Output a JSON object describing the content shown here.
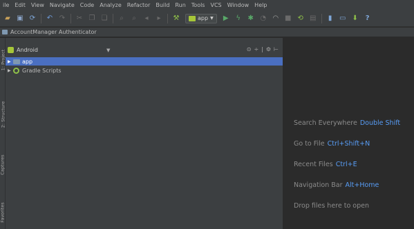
{
  "menubar": [
    "ile",
    "Edit",
    "View",
    "Navigate",
    "Code",
    "Analyze",
    "Refactor",
    "Build",
    "Run",
    "Tools",
    "VCS",
    "Window",
    "Help"
  ],
  "toolbar": {
    "run_config": "app",
    "help_glyph": "?"
  },
  "navbar": {
    "project_name": "AccountManager Authenticator"
  },
  "side_tabs": [
    "1: Project",
    "2: Structure",
    "Captures",
    "Favorites"
  ],
  "project_panel": {
    "view_mode": "Android",
    "tree": [
      {
        "label": "app",
        "selected": true,
        "icon": "folder-icon"
      },
      {
        "label": "Gradle Scripts",
        "selected": false,
        "icon": "gradle-icon"
      }
    ]
  },
  "editor": {
    "hints": [
      {
        "text": "Search Everywhere",
        "key": "Double Shift"
      },
      {
        "text": "Go to File",
        "key": "Ctrl+Shift+N"
      },
      {
        "text": "Recent Files",
        "key": "Ctrl+E"
      },
      {
        "text": "Navigation Bar",
        "key": "Alt+Home"
      },
      {
        "text": "Drop files here to open",
        "key": ""
      }
    ]
  },
  "colors": {
    "selection": "#4a6fc1",
    "shortcut": "#589df6",
    "android_green": "#a6c639"
  }
}
